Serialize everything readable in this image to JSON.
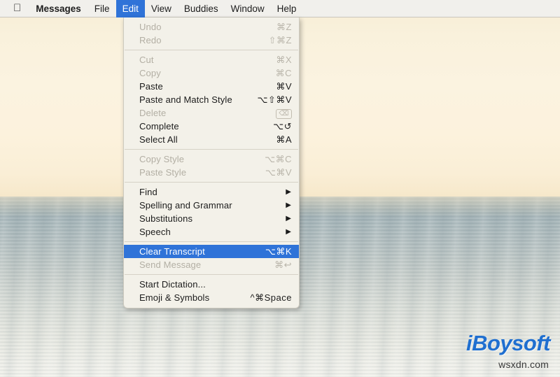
{
  "menubar": {
    "apple_icon": "apple-logo",
    "items": [
      {
        "label": "Messages",
        "bold": true,
        "active": false
      },
      {
        "label": "File",
        "bold": false,
        "active": false
      },
      {
        "label": "Edit",
        "bold": false,
        "active": true
      },
      {
        "label": "View",
        "bold": false,
        "active": false
      },
      {
        "label": "Buddies",
        "bold": false,
        "active": false
      },
      {
        "label": "Window",
        "bold": false,
        "active": false
      },
      {
        "label": "Help",
        "bold": false,
        "active": false
      }
    ]
  },
  "edit_menu": {
    "groups": [
      {
        "items": [
          {
            "label": "Undo",
            "shortcut": "⌘Z",
            "disabled": true,
            "submenu": false,
            "selected": false
          },
          {
            "label": "Redo",
            "shortcut": "⇧⌘Z",
            "disabled": true,
            "submenu": false,
            "selected": false
          }
        ]
      },
      {
        "items": [
          {
            "label": "Cut",
            "shortcut": "⌘X",
            "disabled": true,
            "submenu": false,
            "selected": false
          },
          {
            "label": "Copy",
            "shortcut": "⌘C",
            "disabled": true,
            "submenu": false,
            "selected": false
          },
          {
            "label": "Paste",
            "shortcut": "⌘V",
            "disabled": false,
            "submenu": false,
            "selected": false
          },
          {
            "label": "Paste and Match Style",
            "shortcut": "⌥⇧⌘V",
            "disabled": false,
            "submenu": false,
            "selected": false
          },
          {
            "label": "Delete",
            "shortcut": "⌫",
            "disabled": true,
            "submenu": false,
            "selected": false,
            "boxed_shortcut": true
          },
          {
            "label": "Complete",
            "shortcut": "⌥↺",
            "disabled": false,
            "submenu": false,
            "selected": false
          },
          {
            "label": "Select All",
            "shortcut": "⌘A",
            "disabled": false,
            "submenu": false,
            "selected": false
          }
        ]
      },
      {
        "items": [
          {
            "label": "Copy Style",
            "shortcut": "⌥⌘C",
            "disabled": true,
            "submenu": false,
            "selected": false
          },
          {
            "label": "Paste Style",
            "shortcut": "⌥⌘V",
            "disabled": true,
            "submenu": false,
            "selected": false
          }
        ]
      },
      {
        "items": [
          {
            "label": "Find",
            "shortcut": "",
            "disabled": false,
            "submenu": true,
            "selected": false
          },
          {
            "label": "Spelling and Grammar",
            "shortcut": "",
            "disabled": false,
            "submenu": true,
            "selected": false
          },
          {
            "label": "Substitutions",
            "shortcut": "",
            "disabled": false,
            "submenu": true,
            "selected": false
          },
          {
            "label": "Speech",
            "shortcut": "",
            "disabled": false,
            "submenu": true,
            "selected": false
          }
        ]
      },
      {
        "items": [
          {
            "label": "Clear Transcript",
            "shortcut": "⌥⌘K",
            "disabled": false,
            "submenu": false,
            "selected": true
          },
          {
            "label": "Send Message",
            "shortcut": "⌘↩",
            "disabled": true,
            "submenu": false,
            "selected": false
          }
        ]
      },
      {
        "items": [
          {
            "label": "Start Dictation...",
            "shortcut": "",
            "disabled": false,
            "submenu": false,
            "selected": false
          },
          {
            "label": "Emoji & Symbols",
            "shortcut": "^⌘Space",
            "disabled": false,
            "submenu": false,
            "selected": false
          }
        ]
      }
    ]
  },
  "watermark": {
    "brand": "iBoysoft",
    "site": "wsxdn.com"
  },
  "colors": {
    "accent": "#2f73d8",
    "menu_bg": "#f3f1e9",
    "menubar_bg": "#f1f0ec",
    "disabled_text": "#b3afa4",
    "watermark_blue": "#1f6fd0"
  }
}
